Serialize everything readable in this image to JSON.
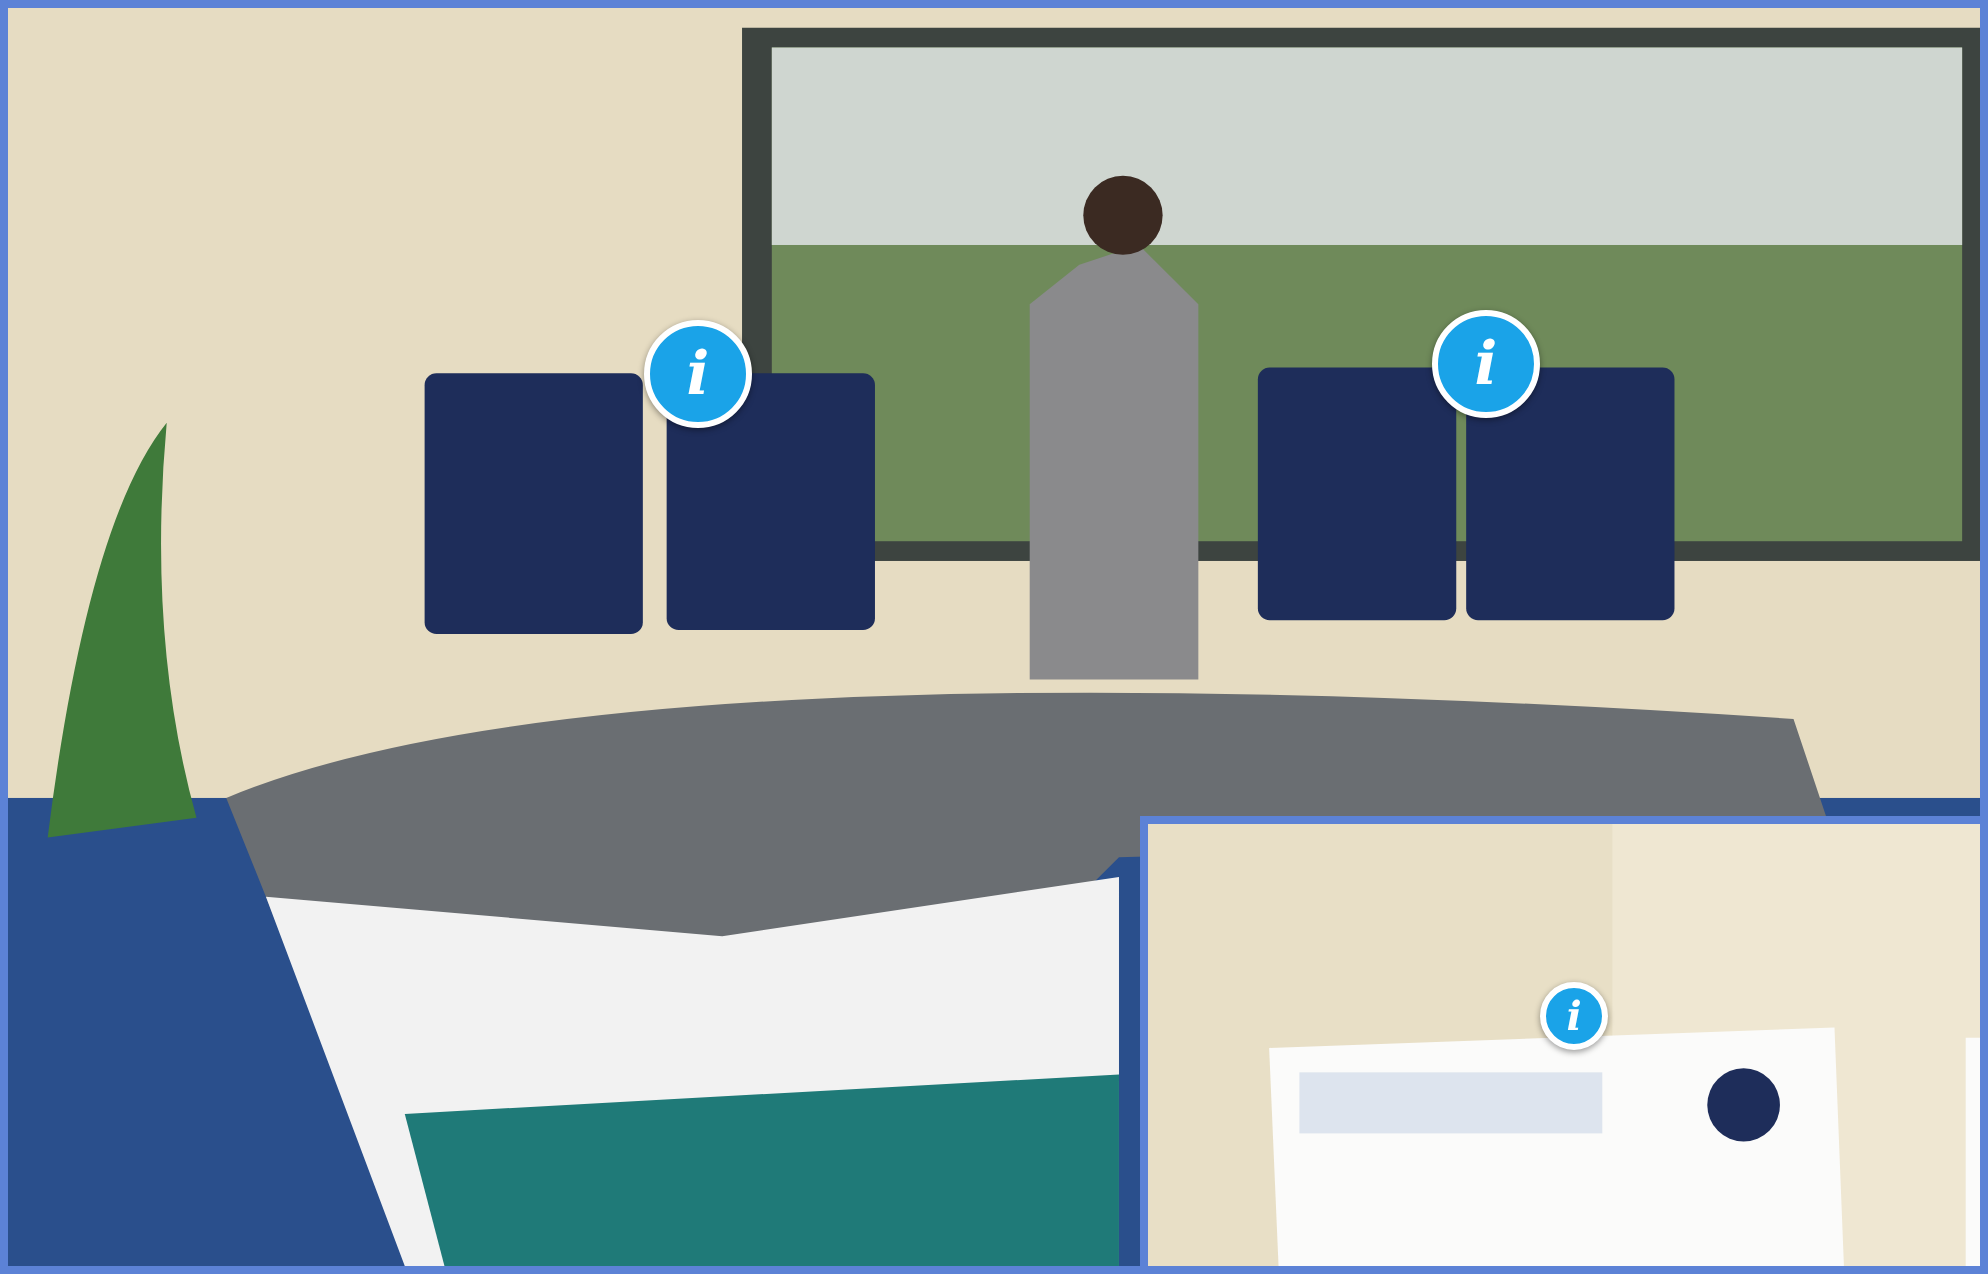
{
  "scene": {
    "kind": "picture",
    "info_buttons": [
      {
        "symbol": "i"
      },
      {
        "symbol": "i"
      }
    ]
  },
  "inset": {
    "kind": "picture",
    "info_buttons": [
      {
        "symbol": "i"
      }
    ]
  }
}
